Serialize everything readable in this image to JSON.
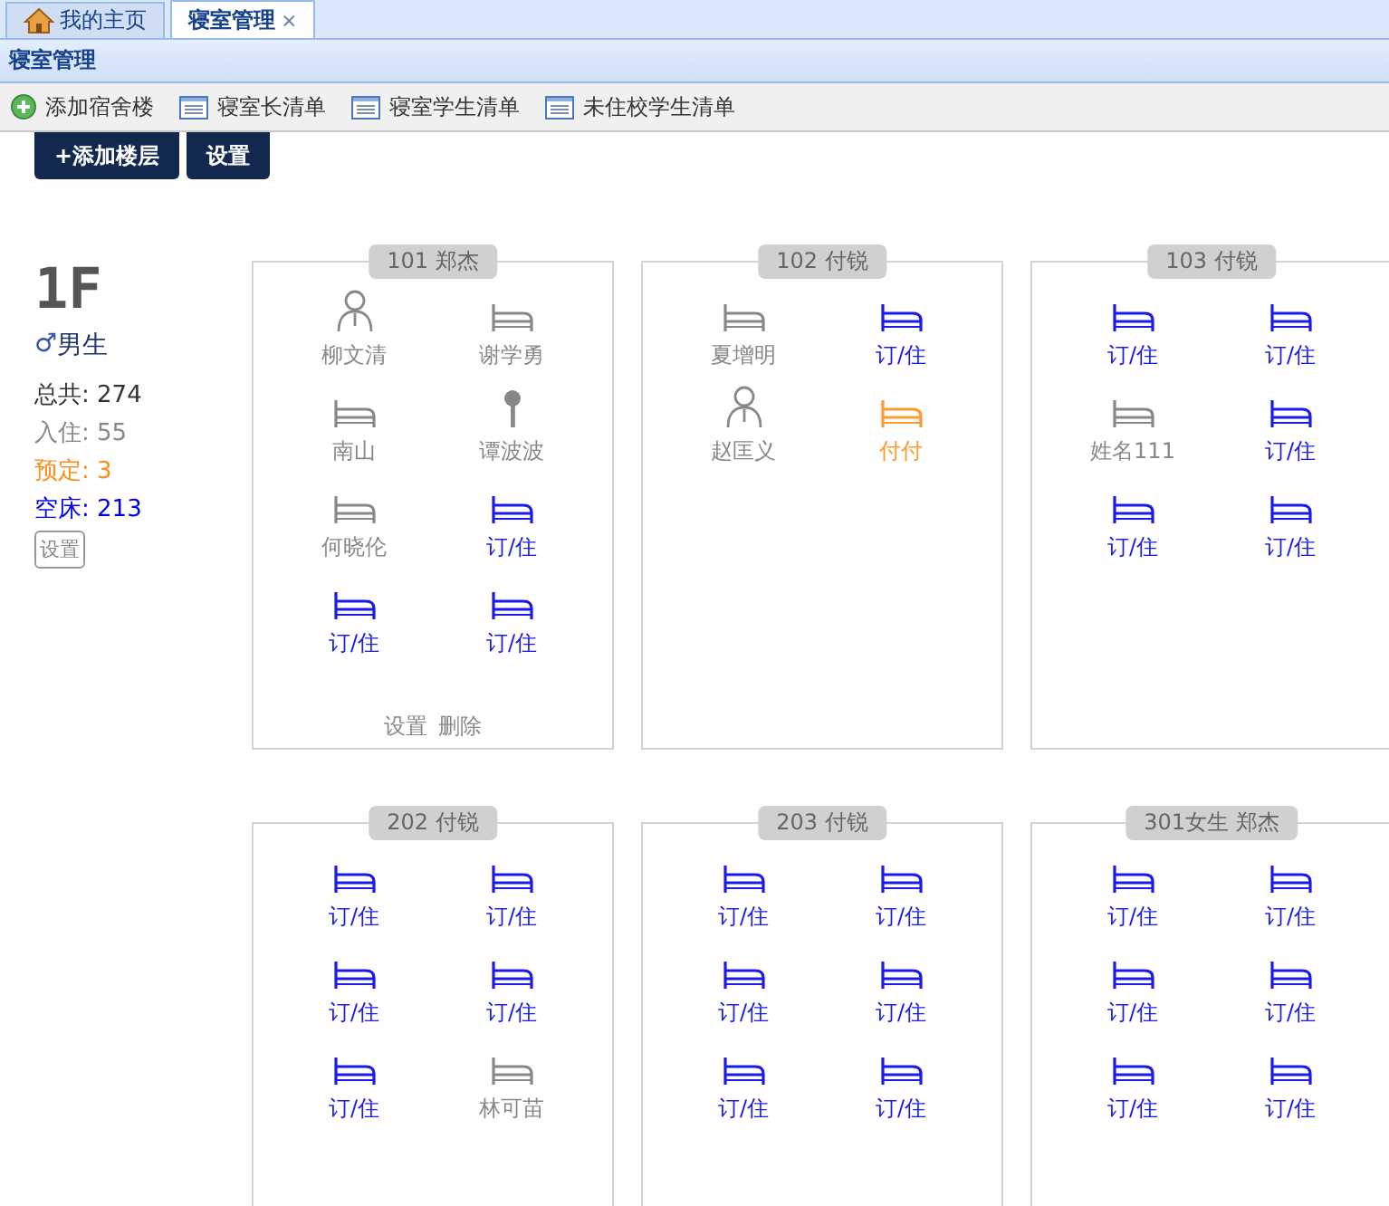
{
  "tabs": [
    {
      "label": "我的主页",
      "selected": false
    },
    {
      "label": "寝室管理",
      "selected": true,
      "close": "×"
    }
  ],
  "panel": {
    "title": "寝室管理"
  },
  "toolbar": [
    {
      "label": "添加宿舍楼",
      "kind": "add"
    },
    {
      "label": "寝室长清单",
      "kind": "list"
    },
    {
      "label": "寝室学生清单",
      "kind": "list"
    },
    {
      "label": "未住校学生清单",
      "kind": "list"
    }
  ],
  "buttons": [
    "+添加楼层",
    "设置"
  ],
  "floor": {
    "name": "1F",
    "gender_symbol": "♂",
    "gender": "男生",
    "stats": [
      {
        "label": "总共:",
        "value": "274",
        "color": "#333333"
      },
      {
        "label": "入住:",
        "value": "55",
        "color": "#888888"
      },
      {
        "label": "预定:",
        "value": "3",
        "color": "#ff8c1a"
      },
      {
        "label": "空床:",
        "value": "213",
        "color": "#0000ee"
      }
    ],
    "settings": "设置"
  },
  "rooms": [
    {
      "title": "101 郑杰",
      "actions": [
        "设置",
        "删除"
      ],
      "beds": [
        {
          "kind": "person",
          "color": "#888888",
          "label": "柳文清"
        },
        {
          "kind": "bed",
          "color": "#888888",
          "label": "谢学勇"
        },
        {
          "kind": "bed",
          "color": "#888888",
          "label": "南山"
        },
        {
          "kind": "key",
          "color": "#888888",
          "label": "谭波波"
        },
        {
          "kind": "bed",
          "color": "#888888",
          "label": "何晓伦"
        },
        {
          "kind": "bed",
          "color": "#1a1aee",
          "label": "订/住"
        },
        {
          "kind": "bed",
          "color": "#1a1aee",
          "label": "订/住"
        },
        {
          "kind": "bed",
          "color": "#1a1aee",
          "label": "订/住"
        }
      ]
    },
    {
      "title": "102 付锐",
      "beds": [
        {
          "kind": "bed",
          "color": "#888888",
          "label": "夏增明"
        },
        {
          "kind": "bed",
          "color": "#1a1aee",
          "label": "订/住"
        },
        {
          "kind": "person",
          "color": "#888888",
          "label": "赵匡义"
        },
        {
          "kind": "bed",
          "color": "#ff9a2e",
          "label": "付付"
        }
      ]
    },
    {
      "title": "103 付锐",
      "beds": [
        {
          "kind": "bed",
          "color": "#1a1aee",
          "label": "订/住"
        },
        {
          "kind": "bed",
          "color": "#1a1aee",
          "label": "订/住"
        },
        {
          "kind": "bed",
          "color": "#888888",
          "label": "姓名111"
        },
        {
          "kind": "bed",
          "color": "#1a1aee",
          "label": "订/住"
        },
        {
          "kind": "bed",
          "color": "#1a1aee",
          "label": "订/住"
        },
        {
          "kind": "bed",
          "color": "#1a1aee",
          "label": "订/住"
        }
      ]
    },
    {
      "title": "202 付锐",
      "beds": [
        {
          "kind": "bed",
          "color": "#1a1aee",
          "label": "订/住"
        },
        {
          "kind": "bed",
          "color": "#1a1aee",
          "label": "订/住"
        },
        {
          "kind": "bed",
          "color": "#1a1aee",
          "label": "订/住"
        },
        {
          "kind": "bed",
          "color": "#1a1aee",
          "label": "订/住"
        },
        {
          "kind": "bed",
          "color": "#1a1aee",
          "label": "订/住"
        },
        {
          "kind": "bed",
          "color": "#888888",
          "label": "林可苗"
        }
      ]
    },
    {
      "title": "203 付锐",
      "beds": [
        {
          "kind": "bed",
          "color": "#1a1aee",
          "label": "订/住"
        },
        {
          "kind": "bed",
          "color": "#1a1aee",
          "label": "订/住"
        },
        {
          "kind": "bed",
          "color": "#1a1aee",
          "label": "订/住"
        },
        {
          "kind": "bed",
          "color": "#1a1aee",
          "label": "订/住"
        },
        {
          "kind": "bed",
          "color": "#1a1aee",
          "label": "订/住"
        },
        {
          "kind": "bed",
          "color": "#1a1aee",
          "label": "订/住"
        }
      ]
    },
    {
      "title": "301女生 郑杰",
      "beds": [
        {
          "kind": "bed",
          "color": "#1a1aee",
          "label": "订/住"
        },
        {
          "kind": "bed",
          "color": "#1a1aee",
          "label": "订/住"
        },
        {
          "kind": "bed",
          "color": "#1a1aee",
          "label": "订/住"
        },
        {
          "kind": "bed",
          "color": "#1a1aee",
          "label": "订/住"
        },
        {
          "kind": "bed",
          "color": "#1a1aee",
          "label": "订/住"
        },
        {
          "kind": "bed",
          "color": "#1a1aee",
          "label": "订/住"
        }
      ]
    }
  ]
}
